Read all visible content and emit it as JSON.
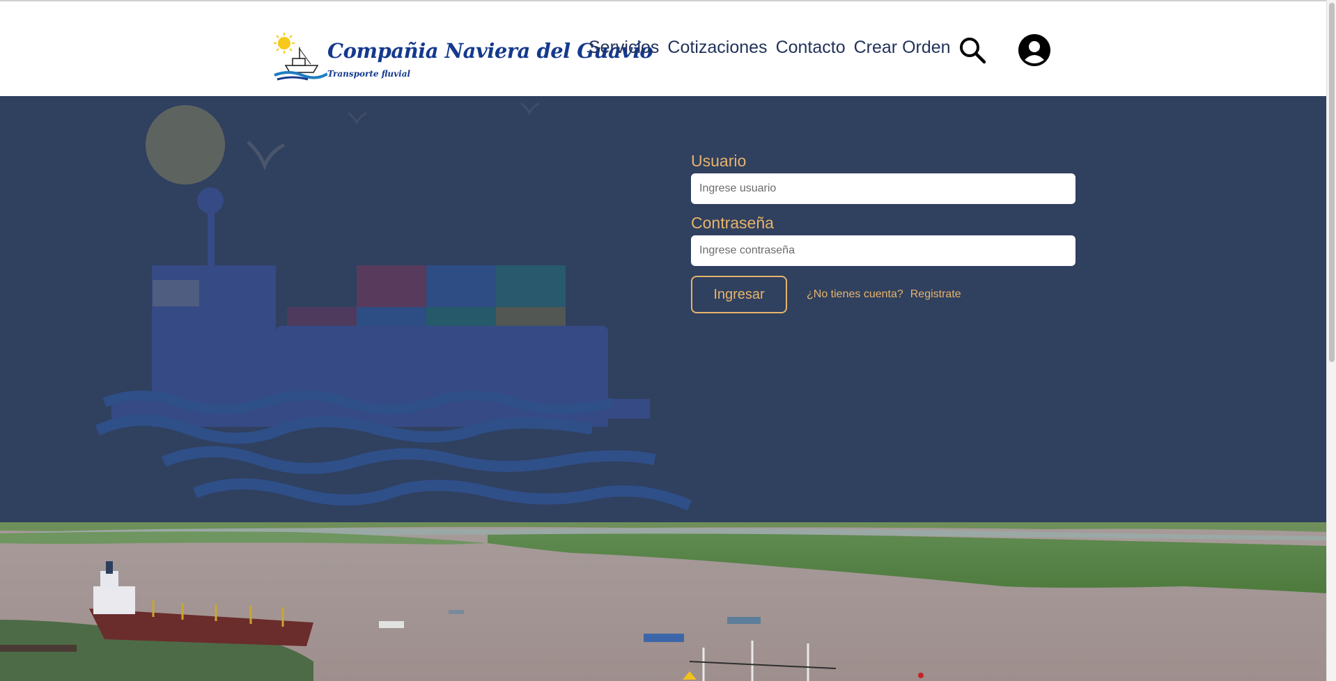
{
  "brand": {
    "name": "Compañia Naviera del Guavío",
    "tagline": "Transporte fluvial",
    "primary_color": "#14398e",
    "accent_color": "#e7b46a",
    "hero_color": "#30405f"
  },
  "nav": {
    "items": [
      {
        "label": "Servicios"
      },
      {
        "label": "Cotizaciones"
      },
      {
        "label": "Contacto"
      },
      {
        "label": "Crear Orden"
      }
    ],
    "search_icon": "search-icon",
    "profile_icon": "user-circle-icon"
  },
  "login": {
    "user_label": "Usuario",
    "user_placeholder": "Ingrese usuario",
    "user_value": "",
    "password_label": "Contraseña",
    "password_placeholder": "Ingrese contraseña",
    "password_value": "",
    "submit_label": "Ingresar",
    "no_account_text": "¿No tienes cuenta?",
    "register_label": "Registrate"
  },
  "hero": {
    "illustration": "cargo-ship-illustration"
  },
  "photo": {
    "subject": "river-port-aerial-photo"
  }
}
